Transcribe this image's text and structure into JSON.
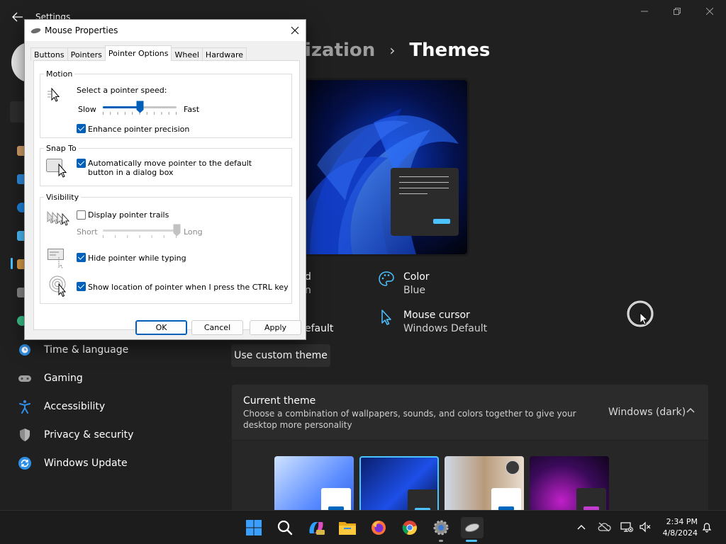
{
  "settings": {
    "window_title": "Settings",
    "breadcrumb": {
      "parent": "ization",
      "separator": "›",
      "current": "Themes"
    },
    "nav_items": [
      {
        "id": "time-language",
        "label": "Time & language"
      },
      {
        "id": "gaming",
        "label": "Gaming"
      },
      {
        "id": "accessibility",
        "label": "Accessibility"
      },
      {
        "id": "privacy-security",
        "label": "Privacy & security"
      },
      {
        "id": "windows-update",
        "label": "Windows Update"
      }
    ],
    "theme_props": {
      "color_label": "Color",
      "color_value": "Blue",
      "cursor_label": "Mouse cursor",
      "cursor_value": "Windows Default",
      "partial_left_1": "d",
      "partial_left_2": "n",
      "partial_left_3": "efault"
    },
    "use_custom_theme": "Use custom theme",
    "current_theme": {
      "title": "Current theme",
      "description": "Choose a combination of wallpapers, sounds, and colors together to give your desktop more personality",
      "value": "Windows (dark)"
    }
  },
  "dialog": {
    "title": "Mouse Properties",
    "tabs": [
      "Buttons",
      "Pointers",
      "Pointer Options",
      "Wheel",
      "Hardware"
    ],
    "active_tab": "Pointer Options",
    "motion": {
      "group": "Motion",
      "label": "Select a pointer speed:",
      "slow": "Slow",
      "fast": "Fast",
      "speed_fraction": 0.5,
      "enhance": "Enhance pointer precision",
      "enhance_checked": true
    },
    "snap": {
      "group": "Snap To",
      "label": "Automatically move pointer to the default button in a dialog box",
      "checked": true
    },
    "visibility": {
      "group": "Visibility",
      "trails": "Display pointer trails",
      "trails_checked": false,
      "short": "Short",
      "long": "Long",
      "trail_fraction": 1.0,
      "hide": "Hide pointer while typing",
      "hide_checked": true,
      "ctrl": "Show location of pointer when I press the CTRL key",
      "ctrl_checked": true
    },
    "buttons": {
      "ok": "OK",
      "cancel": "Cancel",
      "apply": "Apply"
    }
  },
  "taskbar": {
    "time": "2:34 PM",
    "date": "4/8/2024",
    "apps": [
      "start",
      "search",
      "copilot",
      "file-explorer",
      "firefox",
      "chrome",
      "settings",
      "mouse-properties"
    ]
  },
  "colors": {
    "accent": "#4cc2ff",
    "dialog_accent": "#005fb8",
    "background": "#202020"
  }
}
